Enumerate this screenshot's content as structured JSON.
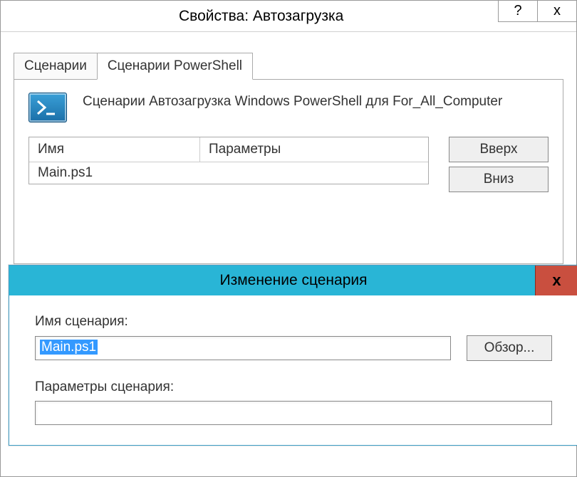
{
  "main": {
    "title": "Свойства: Автозагрузка",
    "help_glyph": "?",
    "close_glyph": "x"
  },
  "tabs": {
    "scripts": "Сценарии",
    "powershell": "Сценарии PowerShell"
  },
  "panel": {
    "heading": "Сценарии Автозагрузка Windows PowerShell для For_All_Computer",
    "col_name": "Имя",
    "col_params": "Параметры",
    "row0_name": "Main.ps1",
    "row0_params": "",
    "btn_up": "Вверх",
    "btn_down": "Вниз"
  },
  "modal": {
    "title": "Изменение сценария",
    "close_glyph": "x",
    "label_name": "Имя сценария:",
    "input_name": "Main.ps1",
    "btn_browse": "Обзор...",
    "label_params": "Параметры сценария:",
    "input_params": ""
  }
}
